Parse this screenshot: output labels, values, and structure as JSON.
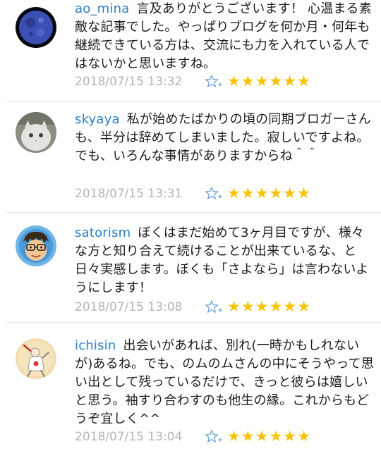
{
  "comments": [
    {
      "user": "ao_mina",
      "body": "言及ありがとうございます！ 心温まる素敵な記事でした。やっぱりブログを何か月・何年も継続できている方は、交流にも力を入れている人ではないかと思いますね。",
      "timestamp": "2018/07/15 13:32",
      "stars": "★★★★★★",
      "star_count": 6,
      "avatar": "moon-avatar"
    },
    {
      "user": "skyaya",
      "body": "私が始めたばかりの頃の同期ブロガーさんも、半分は辞めてしまいました。寂しいですよね。でも、いろんな事情がありますからね＾＾",
      "timestamp": "2018/07/15 13:31",
      "stars": "★★★★★★",
      "star_count": 6,
      "avatar": "cat-avatar"
    },
    {
      "user": "satorism",
      "body": "ぼくはまだ始めて3ヶ月目ですが、様々な方と知り合えて続けることが出来ているな、と日々実感します。ぼくも「さよなら」は言わないようにします！",
      "timestamp": "2018/07/15 13:08",
      "stars": "★★★★★★",
      "star_count": 6,
      "avatar": "cartoon-man-avatar"
    },
    {
      "user": "ichisin",
      "body": "出会いがあれば、別れ(一時かもしれないが)あるね。でも、のムのムさんの中にそうやって思い出として残っているだけで、きっと彼らは嬉しいと思う。袖すり合わすのも他生の縁。これからもどうぞ宜しく^^",
      "timestamp": "2018/07/15 13:04",
      "stars": "★★★★★★",
      "star_count": 6,
      "avatar": "dancing-figure-avatar"
    }
  ],
  "colors": {
    "username": "#2c7fc4",
    "timestamp": "#b4b4b4",
    "star": "#f5c400",
    "add_star": "#6aa5dc",
    "divider": "#e9e9e9"
  }
}
